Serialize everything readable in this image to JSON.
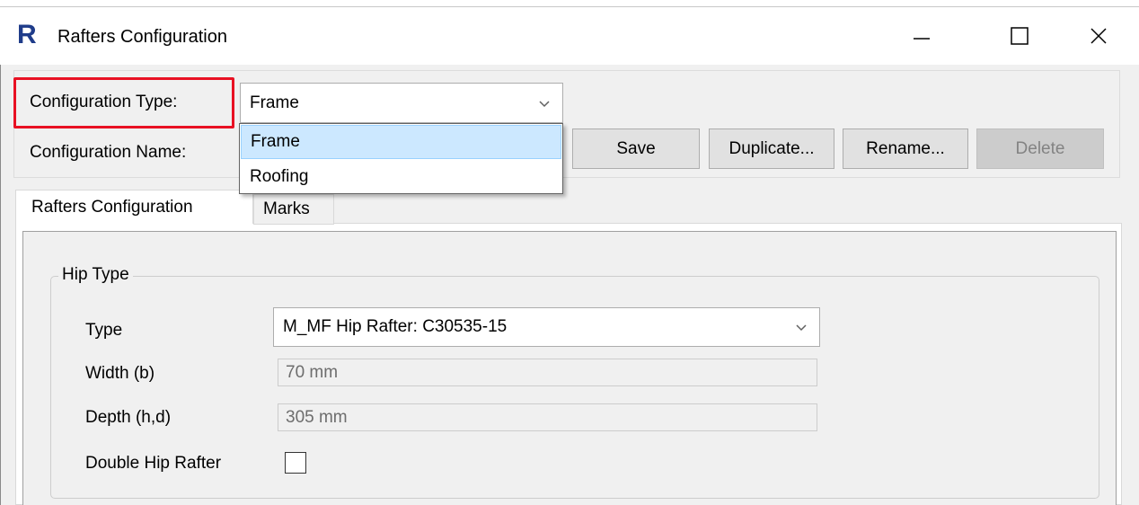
{
  "window": {
    "title": "Rafters Configuration",
    "app_icon_letter": "R"
  },
  "config": {
    "type_label": "Configuration Type:",
    "type_value": "Frame",
    "type_options": [
      "Frame",
      "Roofing"
    ],
    "name_label": "Configuration Name:",
    "highlight_color": "#e81123"
  },
  "buttons": {
    "save": "Save",
    "duplicate": "Duplicate...",
    "rename": "Rename...",
    "delete": "Delete"
  },
  "tabs": [
    {
      "label": "Rafters Configuration",
      "active": true
    },
    {
      "label": "Marks",
      "active": false
    }
  ],
  "hip": {
    "group_label": "Hip Type",
    "type_label": "Type",
    "type_value": "M_MF Hip Rafter: C30535-15",
    "width_label": "Width (b)",
    "width_value": "70 mm",
    "depth_label": "Depth (h,d)",
    "depth_value": "305 mm",
    "double_label": "Double Hip Rafter",
    "double_checked": false
  }
}
